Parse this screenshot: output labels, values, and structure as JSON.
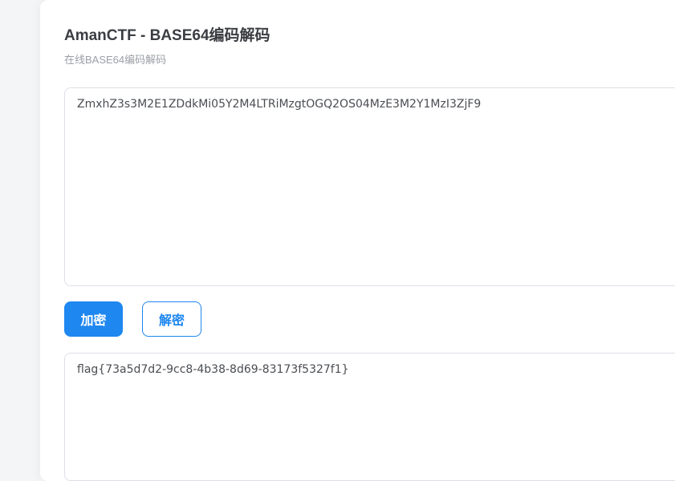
{
  "page": {
    "title": "AmanCTF - BASE64编码解码",
    "subtitle": "在线BASE64编码解码"
  },
  "input": {
    "value": "ZmxhZ3s3M2E1ZDdkMi05Y2M4LTRiMzgtOGQ2OS04MzE3M2Y1MzI3ZjF9"
  },
  "buttons": {
    "encode_label": "加密",
    "decode_label": "解密"
  },
  "output": {
    "value": "flag{73a5d7d2-9cc8-4b38-8d69-83173f5327f1}"
  },
  "colors": {
    "accent": "#1e87f0",
    "title_text": "#3a3d42",
    "subtitle_text": "#9aa0a6",
    "border": "#dcdfe6"
  }
}
